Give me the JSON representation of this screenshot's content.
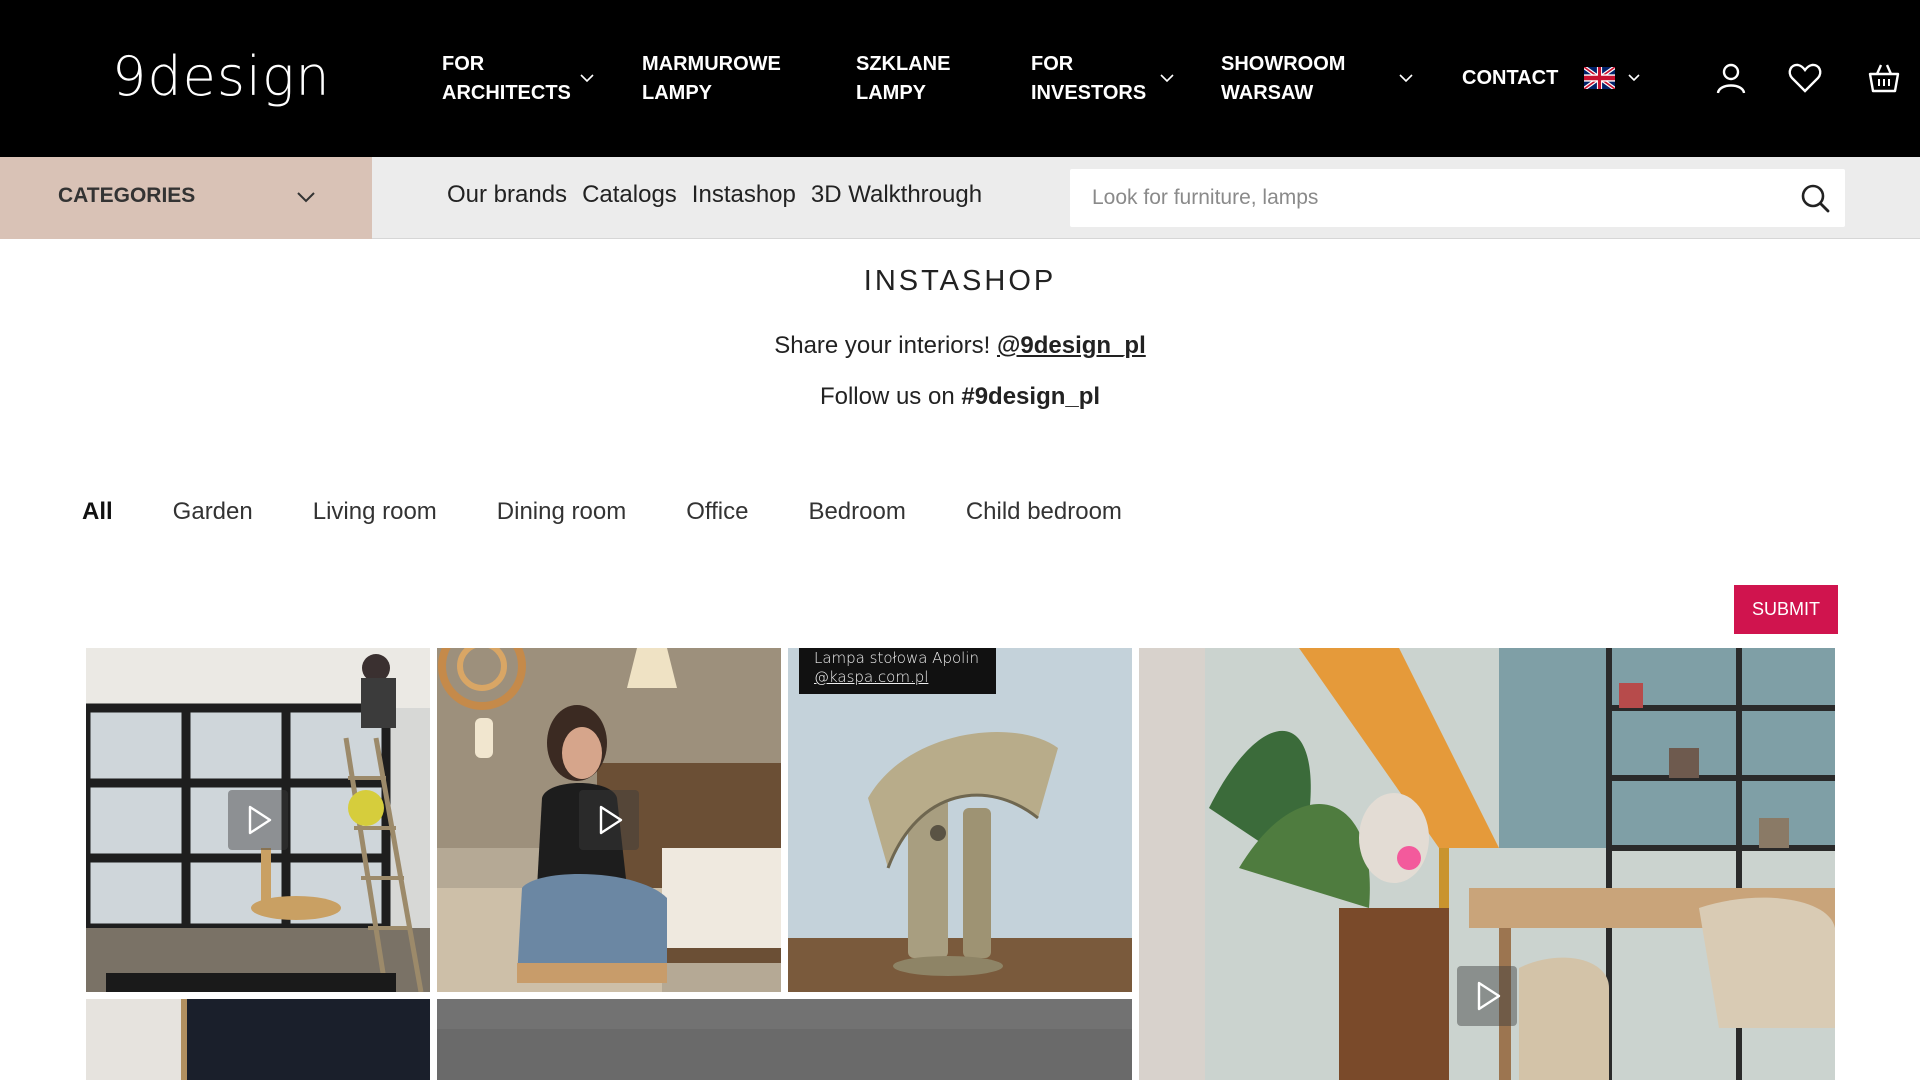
{
  "header": {
    "logo": "9design",
    "nav": [
      {
        "label": "FOR ARCHITECTS",
        "dropdown": true
      },
      {
        "label": "MARMUROWE LAMPY",
        "dropdown": false
      },
      {
        "label": "SZKLANE LAMPY",
        "dropdown": false
      },
      {
        "label": "FOR INVESTORS",
        "dropdown": true
      },
      {
        "label": "SHOWROOM WARSAW",
        "dropdown": true
      },
      {
        "label": "CONTACT",
        "dropdown": false
      }
    ],
    "language_icon": "uk-flag-icon",
    "icons": [
      "account-icon",
      "heart-icon",
      "basket-icon"
    ]
  },
  "subbar": {
    "categories_label": "CATEGORIES",
    "links": [
      "Our brands",
      "Catalogs",
      "Instashop",
      "3D Walkthrough"
    ],
    "search_placeholder": "Look for furniture, lamps"
  },
  "intro": {
    "title": "INSTASHOP",
    "share_text": "Share your interiors!",
    "share_handle": "@9design_pl",
    "follow_text": "Follow us on",
    "follow_tag": "#9design_pl"
  },
  "filters": {
    "items": [
      "All",
      "Garden",
      "Living room",
      "Dining room",
      "Office",
      "Bedroom",
      "Child bedroom"
    ],
    "active": "All"
  },
  "submit_label": "SUBMIT",
  "tiles": [
    {
      "name": "video-lamp-install",
      "video": true
    },
    {
      "name": "video-furniture-assembly",
      "video": true
    },
    {
      "name": "photo-lamp-apolin",
      "video": false,
      "caption_line1": "Lampa stołowa Apolin",
      "caption_line2": "@kaspa.com.pl"
    },
    {
      "name": "video-dining-room",
      "video": true
    }
  ],
  "colors": {
    "header_bg": "#000000",
    "categories_bg": "#d9c2b6",
    "subbar_bg": "#ececec",
    "submit_bg": "#d0144e"
  }
}
